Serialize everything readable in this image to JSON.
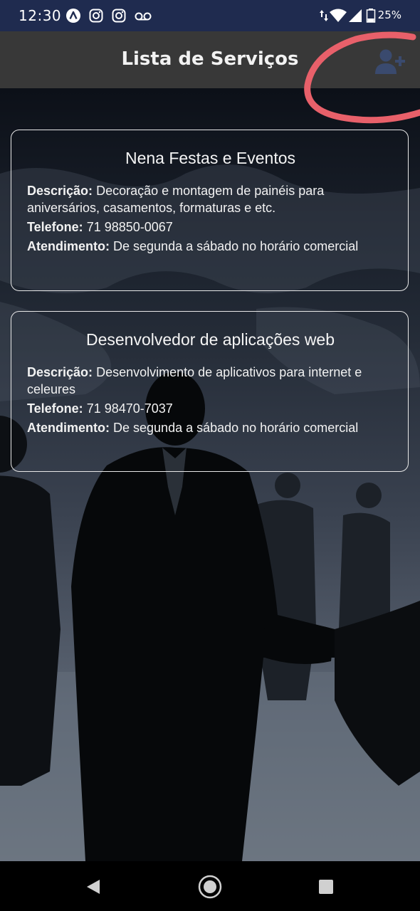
{
  "status_bar": {
    "time": "12:30",
    "battery_percent": "25%",
    "icons": [
      "a-circle-icon",
      "instagram-icon",
      "instagram-icon",
      "voicemail-icon",
      "data-arrows-icon",
      "wifi-icon",
      "signal-icon",
      "battery-icon"
    ]
  },
  "app_bar": {
    "title": "Lista de Serviços",
    "action_icon": "add-user-icon"
  },
  "labels": {
    "description": "Descrição:",
    "phone": "Telefone:",
    "hours": "Atendimento:"
  },
  "services": [
    {
      "name": "Nena Festas e Eventos",
      "description": "Decoração e montagem de painéis para aniversários, casamentos, formaturas e etc.",
      "phone": "71 98850-0067",
      "hours": "De segunda a sábado no horário comercial"
    },
    {
      "name": "Desenvolvedor de aplicações web",
      "description": "Desenvolvimento de aplicativos para internet e celeures",
      "phone": "71 98470-7037",
      "hours": "De segunda a sábado no horário comercial"
    }
  ],
  "nav_bar": {
    "icons": [
      "back-icon",
      "home-icon",
      "recents-icon"
    ]
  },
  "colors": {
    "status_bar": "#1f2b4f",
    "app_bar": "#383838",
    "annotation": "#e8606a",
    "card_border": "#e8e8e8",
    "add_icon": "#3a4a6e"
  }
}
